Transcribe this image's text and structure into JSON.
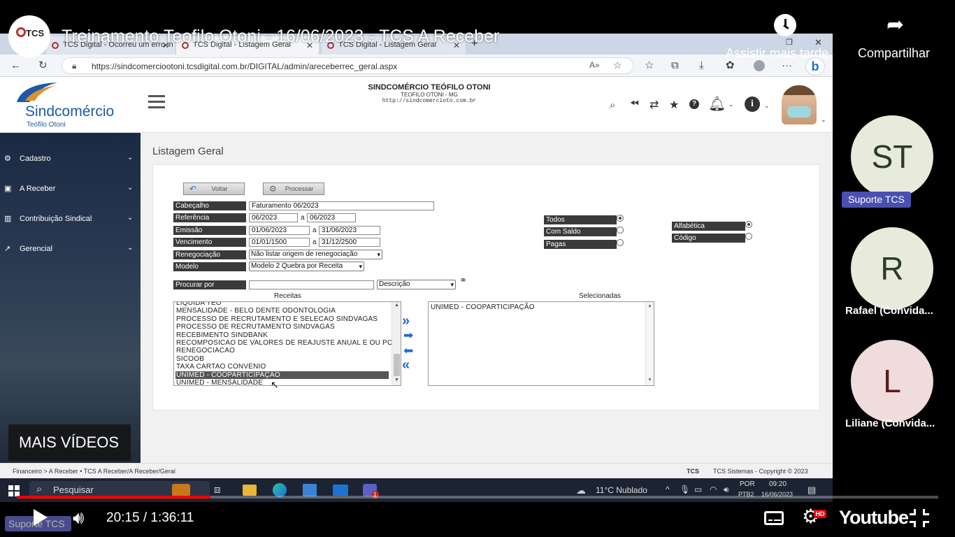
{
  "video": {
    "title": "Treinamento Teofilo Otoni - 16/06/2023 - TCS A Receber",
    "watch_later": "Assistir mais tarde",
    "share": "Compartilhar",
    "more_videos": "MAIS VÍDEOS",
    "time": "20:15 / 1:36:11",
    "brand": "Youtube",
    "hd": "HD",
    "progress_fraction": 0.21,
    "channel_logo_text": "TCS"
  },
  "participants": [
    {
      "initials": "ST",
      "name": "Suporte TCS",
      "bg": "#e8eadc"
    },
    {
      "initials": "R",
      "name": "Rafael (Convida...",
      "bg": "#e8eadc"
    },
    {
      "initials": "L",
      "name": "Liliane (Convida...",
      "bg": "#f0dcdc"
    }
  ],
  "presenter_tag": "Suporte TCS",
  "browser": {
    "tabs": [
      "TCS Digital - Ocorreu um erro in",
      "TCS Digital - Listagem Geral",
      "TCS Digital - Listagem Geral"
    ],
    "url": "https://sindcomerciootoni.tcsdigital.com.br/DIGITAL/admin/areceberrec_geral.aspx"
  },
  "app": {
    "org": "SINDCOMÉRCIO TEÓFILO OTONI",
    "city": "TEOFILO OTONI - MG",
    "site": "http://sindcomercioto.com.br",
    "logo_main": "Sindcomércio",
    "logo_sub": "Teófilo Otoni"
  },
  "sidebar": {
    "items": [
      "Cadastro",
      "A Receber",
      "Contribuição Sindical",
      "Gerencial"
    ]
  },
  "page": {
    "title": "Listagem Geral",
    "btn_back": "Voltar",
    "btn_process": "Processar"
  },
  "form": {
    "cabecalho": {
      "label": "Cabeçalho",
      "value": "Faturamento 06/2023"
    },
    "referencia": {
      "label": "Referência",
      "from": "06/2023",
      "to": "06/2023"
    },
    "emissao": {
      "label": "Emissão",
      "from": "01/06/2023",
      "to": "31/06/2023"
    },
    "vencimento": {
      "label": "Vencimento",
      "from": "01/01/1500",
      "to": "31/12/2500"
    },
    "range_sep": "a",
    "renegociacao": {
      "label": "Renegociação",
      "value": "Não listar origem de renegociação"
    },
    "modelo": {
      "label": "Modelo",
      "value": "Modelo 2 Quebra por Receita"
    },
    "procurar": {
      "label": "Procurar por",
      "value": "",
      "field": "Descrição"
    },
    "status": [
      {
        "label": "Todos",
        "checked": true
      },
      {
        "label": "Com Saldo",
        "checked": false
      },
      {
        "label": "Pagas",
        "checked": false
      }
    ],
    "ordem": [
      {
        "label": "Alfabética",
        "checked": true
      },
      {
        "label": "Código",
        "checked": false
      }
    ]
  },
  "lists": {
    "receitas_title": "Receitas",
    "selecionadas_title": "Selecionadas",
    "receitas": [
      "LIQUIDA TEO",
      "MENSALIDADE - BELO DENTE ODONTOLOGIA",
      "PROCESSO DE RECRUTAMENTO E SELECAO SINDVAGAS",
      "PROCESSO DE RECRUTAMENTO SINDVAGAS",
      "RECEBIMENTO SINDBANK",
      "RECOMPOSICAO DE VALORES DE REAJUSTE ANUAL E OU PO",
      "RENEGOCIACAO",
      "SICOOB",
      "TAXA CARTAO CONVENIO",
      "UNIMED - COOPARTICIPAÇÃO",
      "UNIMED - MENSALIDADE"
    ],
    "selected_index": 9,
    "selecionadas": [
      "UNIMED - COOPARTICIPAÇÃO"
    ]
  },
  "footer": {
    "breadcrumb": "Financeiro > A Receber • TCS A Receber/A Receber/Geral",
    "copyright": "TCS Sistemas - Copyright © 2023",
    "brand": "TCS"
  },
  "taskbar": {
    "search": "Pesquisar",
    "weather": "11°C  Nublado",
    "lang1": "POR",
    "lang2": "PTB2",
    "clock": "09:20",
    "date": "16/06/2023",
    "teams_badge": "1"
  }
}
